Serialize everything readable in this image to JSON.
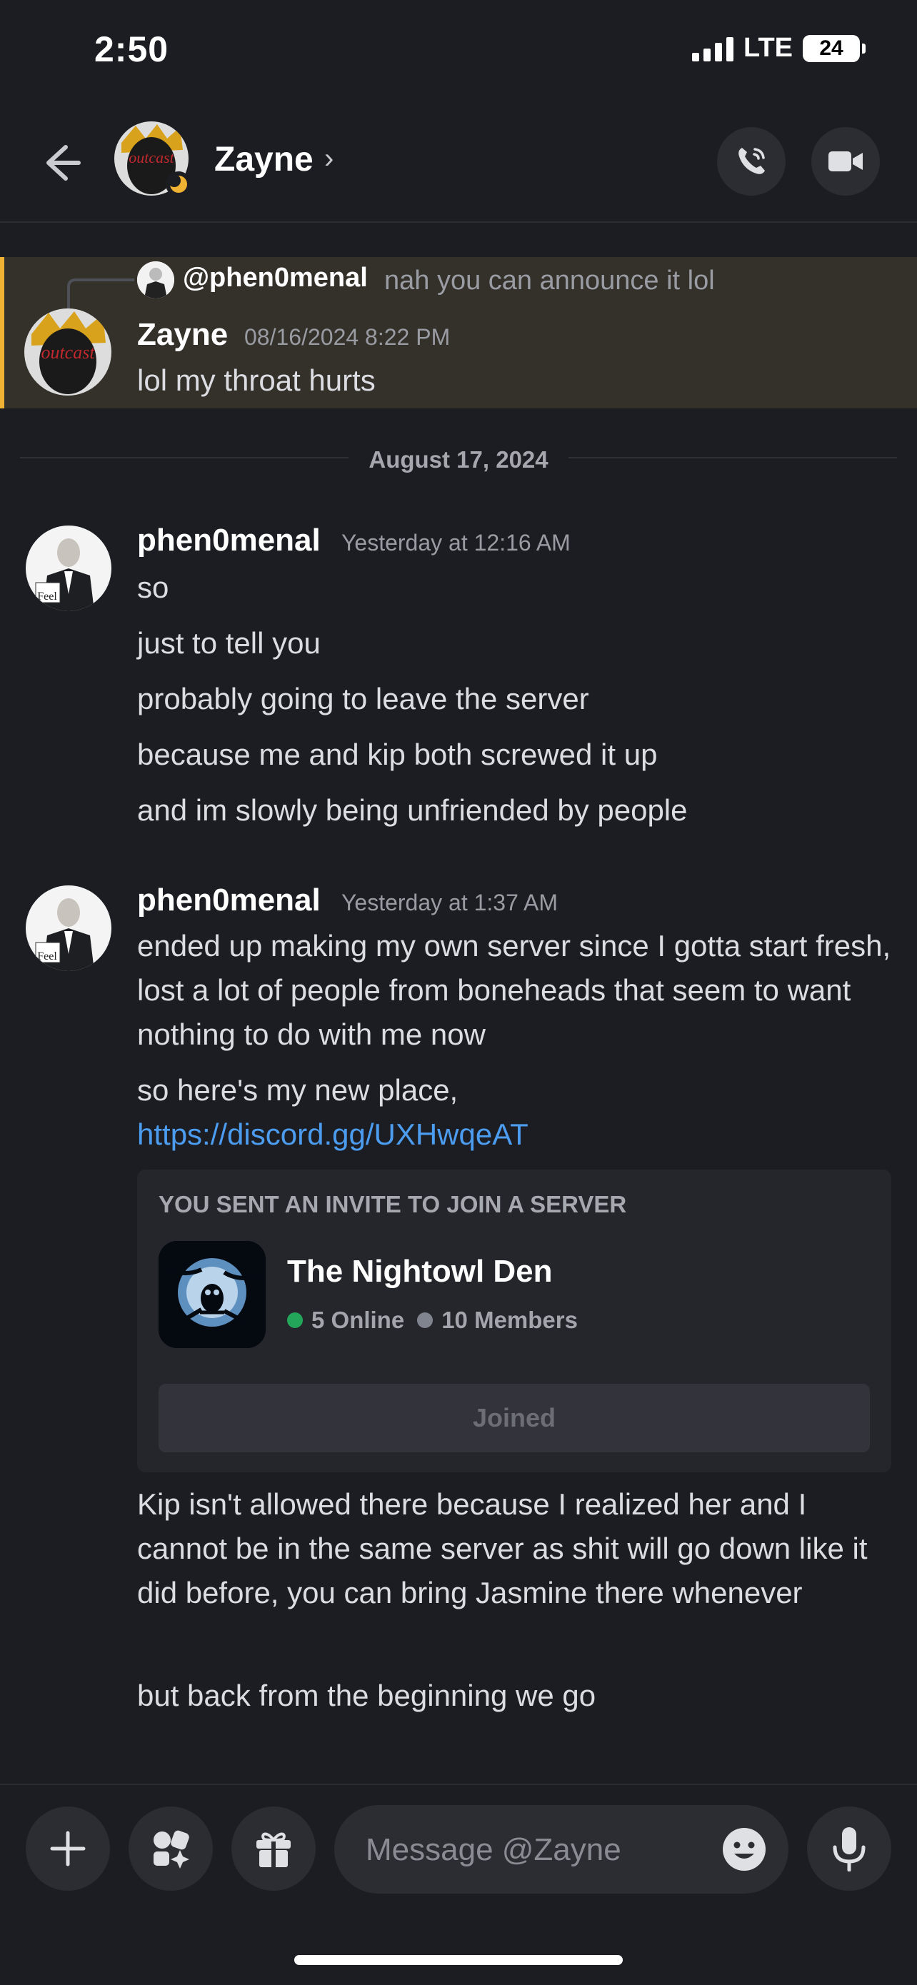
{
  "status_bar": {
    "time": "2:50",
    "network": "LTE",
    "battery": "24"
  },
  "header": {
    "name": "Zayne",
    "chevron": "›",
    "icons": [
      "back-arrow-icon",
      "phone-call-icon",
      "video-camera-icon"
    ]
  },
  "highlighted_message": {
    "reply_to": "@phen0menal",
    "reply_text": "nah you can announce it lol",
    "author": "Zayne",
    "timestamp": "08/16/2024 8:22 PM",
    "text": "lol my throat hurts",
    "accent_color": "#f0b232"
  },
  "date_divider": "August 17, 2024",
  "message_groups": [
    {
      "author": "phen0menal",
      "timestamp": "Yesterday at 12:16 AM",
      "lines": [
        "so",
        "just to tell you",
        "probably going to leave the server",
        "because me and kip both screwed it up",
        "and im slowly being unfriended by people"
      ]
    },
    {
      "author": "phen0menal",
      "timestamp": "Yesterday at 1:37 AM",
      "paragraph1": "ended up making my own server since I gotta start fresh, lost a lot of people from boneheads that seem to want nothing to do with me now",
      "paragraph2_text": "so here's my new place, ",
      "paragraph2_link": "https://discord.gg/UXHwqeAT",
      "invite": {
        "heading": "YOU SENT AN INVITE TO JOIN A SERVER",
        "server_name": "The Nightowl Den",
        "online": "5 Online",
        "members": "10 Members",
        "button": "Joined",
        "online_color": "#23a55a",
        "members_color": "#80848e"
      },
      "paragraph3": "Kip isn't allowed there because I realized her and I cannot be in the same server as shit will go down like it did before, you can bring Jasmine there whenever",
      "paragraph4": "but back from the beginning we go"
    }
  ],
  "composer": {
    "placeholder": "Message @Zayne",
    "icons": [
      "plus-icon",
      "apps-icon",
      "gift-icon",
      "emoji-icon",
      "microphone-icon"
    ]
  }
}
